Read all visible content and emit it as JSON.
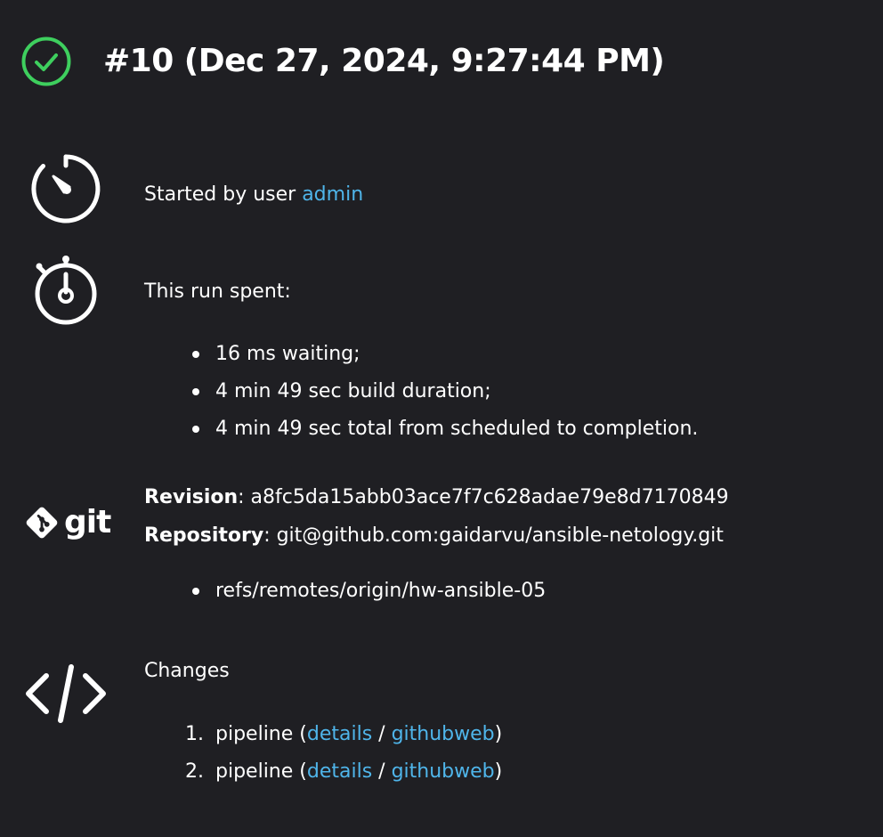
{
  "header": {
    "title": "#10 (Dec 27, 2024, 9:27:44 PM)",
    "status_icon": "success-check-circle-icon",
    "status_color": "#3ecf5e"
  },
  "trigger": {
    "icon": "timer-icon",
    "text": "Started by user ",
    "user_link": "admin"
  },
  "timing": {
    "icon": "stopwatch-icon",
    "heading": "This run spent:",
    "items": [
      "16 ms waiting;",
      "4 min 49 sec build duration;",
      "4 min 49 sec total from scheduled to completion."
    ]
  },
  "git": {
    "icon": "git-logo-icon",
    "logo_text": "git",
    "revision_label": "Revision",
    "revision_value": ": a8fc5da15abb03ace7f7c628adae79e8d7170849",
    "repository_label": "Repository",
    "repository_value": ": git@github.com:gaidarvu/ansible-netology.git",
    "branches": [
      "refs/remotes/origin/hw-ansible-05"
    ]
  },
  "changes": {
    "icon": "code-brackets-icon",
    "heading": "Changes",
    "items": [
      {
        "number": "1.",
        "name": "pipeline (",
        "details_link": "details",
        "separator": " / ",
        "githubweb_link": "githubweb",
        "close": ")"
      },
      {
        "number": "2.",
        "name": "pipeline (",
        "details_link": "details",
        "separator": " / ",
        "githubweb_link": "githubweb",
        "close": ")"
      }
    ]
  },
  "colors": {
    "background": "#1f1f23",
    "text": "#ffffff",
    "link": "#4fb5ea",
    "success": "#3ecf5e"
  }
}
